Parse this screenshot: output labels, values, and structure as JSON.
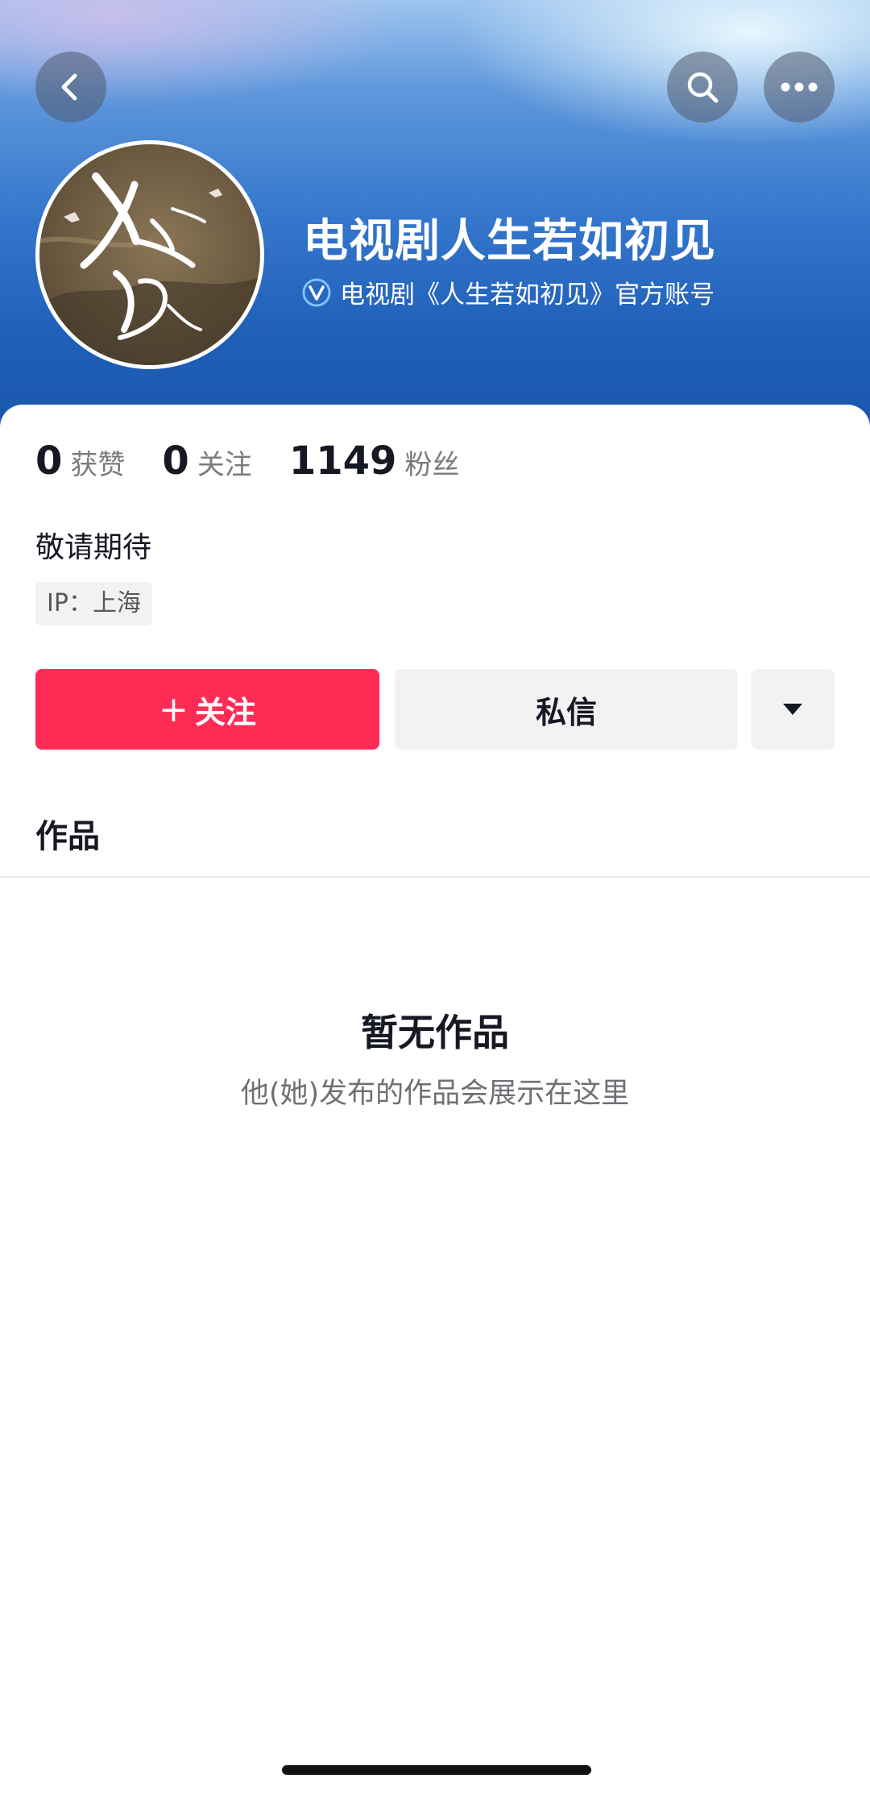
{
  "header": {
    "back_icon": "chevron-left-icon",
    "search_icon": "search-icon",
    "more_icon": "more-horizontal-icon"
  },
  "profile": {
    "name": "电视剧人生若如初见",
    "verification": "电视剧《人生若如初见》官方账号",
    "verified_badge_color": "#4ea5f5",
    "bio": "敬请期待",
    "ip_location": "IP：上海"
  },
  "stats": [
    {
      "value": "0",
      "label": "获赞"
    },
    {
      "value": "0",
      "label": "关注"
    },
    {
      "value": "1149",
      "label": "粉丝"
    }
  ],
  "actions": {
    "follow_plus": "+",
    "follow_label": "关注",
    "message_label": "私信",
    "more_icon": "caret-down-icon"
  },
  "tabs": {
    "works_label": "作品"
  },
  "empty_state": {
    "title": "暂无作品",
    "description": "他(她)发布的作品会展示在这里"
  },
  "colors": {
    "accent": "#fe2c55",
    "banner_top": "#9dc4ee",
    "banner_bottom": "#1a55ac"
  }
}
